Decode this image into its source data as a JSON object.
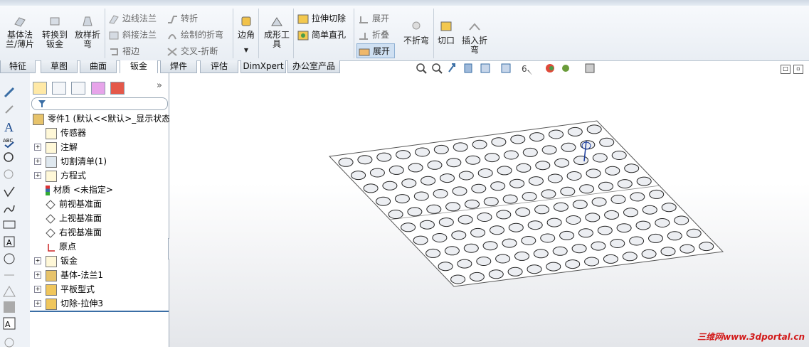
{
  "ribbon": {
    "big_buttons": [
      {
        "label1": "基体法",
        "label2": "兰/薄片"
      },
      {
        "label1": "转换到",
        "label2": "钣金"
      },
      {
        "label1": "放样折",
        "label2": "弯"
      }
    ],
    "col1": [
      "边线法兰",
      "斜接法兰",
      "褶边"
    ],
    "col2": [
      "转折",
      "绘制的折弯",
      "交叉-折断"
    ],
    "corner": "边角",
    "forming_tool1": "成形工",
    "forming_tool2": "具",
    "col3": [
      "拉伸切除",
      "简单直孔"
    ],
    "col4": [
      "展开",
      "折叠",
      "展开"
    ],
    "no_bend": "不折弯",
    "cut": "切口",
    "insert_bend1": "插入折",
    "insert_bend2": "弯"
  },
  "tabs": [
    "特征",
    "草图",
    "曲面",
    "钣金",
    "焊件",
    "评估",
    "DimXpert",
    "办公室产品"
  ],
  "tree": {
    "root": "零件1 (默认<<默认>_显示状态",
    "items": [
      "传感器",
      "注解",
      "切割清单(1)",
      "方程式",
      "材质 <未指定>",
      "前视基准面",
      "上视基准面",
      "右视基准面",
      "原点",
      "钣金",
      "基体-法兰1",
      "平板型式",
      "切除-拉伸3"
    ]
  },
  "watermark": "三维网www.3dportal.cn",
  "colors": {
    "accent": "#3a6ea5",
    "active_tab": "#ffffff",
    "watermark": "#d21a1a"
  }
}
